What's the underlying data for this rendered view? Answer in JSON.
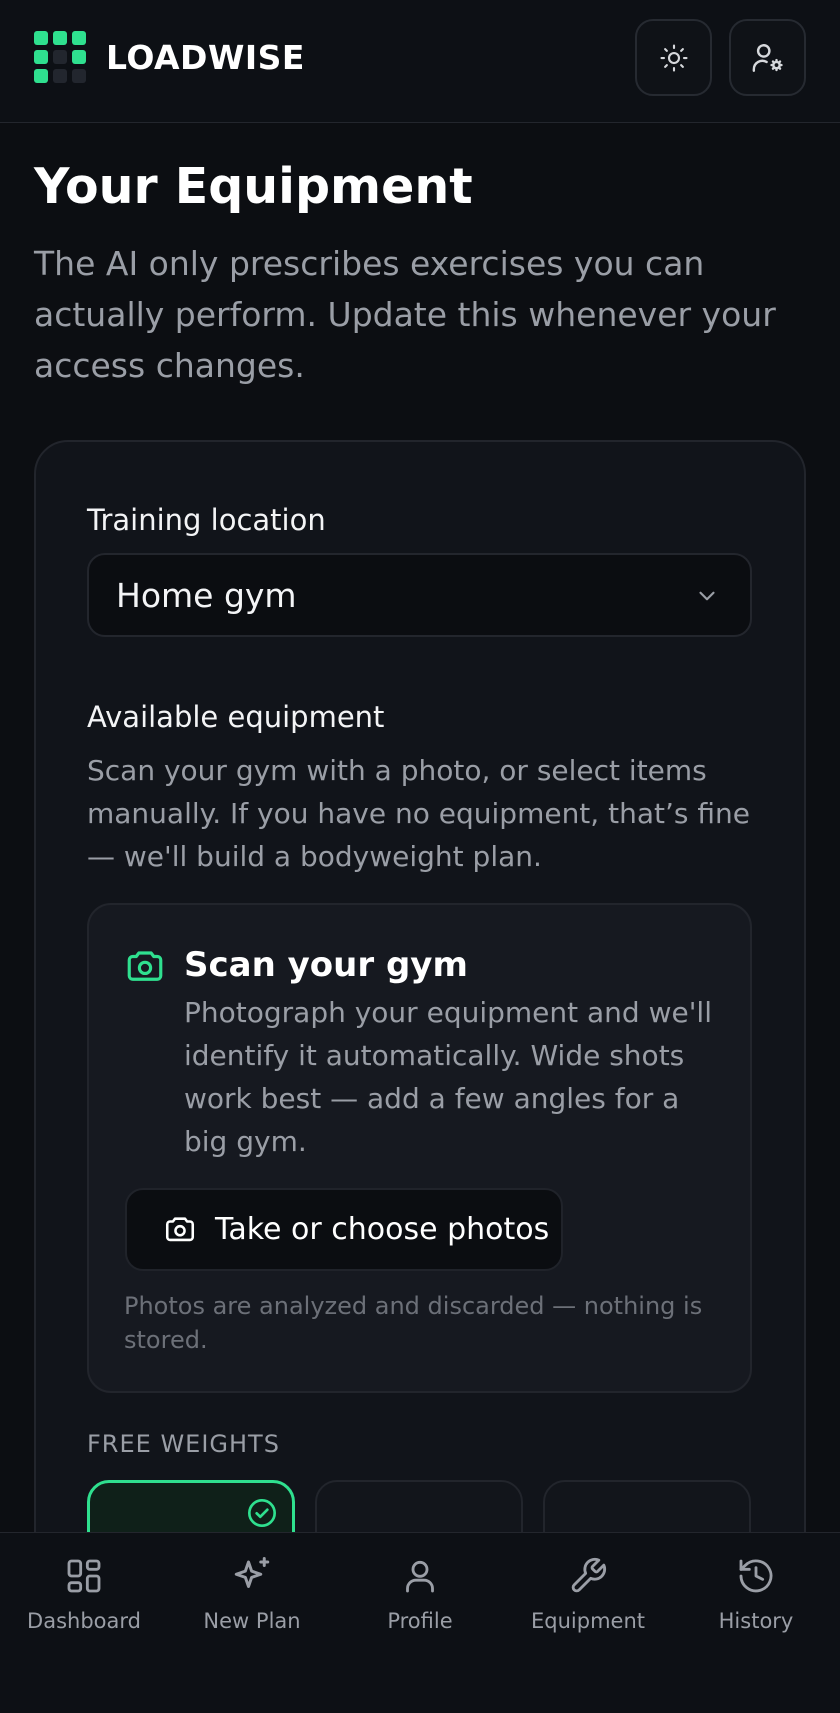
{
  "app": {
    "name": "LOADWISE"
  },
  "header": {
    "theme_button": "sun-icon",
    "account_button": "user-settings-icon"
  },
  "page": {
    "title": "Your Equipment",
    "description": "The AI only prescribes exercises you can actually perform. Update this whenever your access changes."
  },
  "form": {
    "location_label": "Training location",
    "location_value": "Home gym",
    "equipment_label": "Available equipment",
    "equipment_help": "Scan your gym with a photo, or select items manually. If you have no equipment, that’s fine — we'll build a bodyweight plan."
  },
  "scan": {
    "title": "Scan your gym",
    "description": "Photograph your equipment and we'll identify it automatically. Wide shots work best — add a few angles for a big gym.",
    "button_label": "Take or choose photos",
    "note": "Photos are analyzed and discarded — nothing is stored."
  },
  "equipment": {
    "section_title": "FREE WEIGHTS"
  },
  "nav": {
    "items": [
      {
        "label": "Dashboard",
        "icon": "dashboard-icon"
      },
      {
        "label": "New Plan",
        "icon": "sparkles-icon"
      },
      {
        "label": "Profile",
        "icon": "user-icon"
      },
      {
        "label": "Equipment",
        "icon": "wrench-icon"
      },
      {
        "label": "History",
        "icon": "history-icon"
      }
    ]
  },
  "colors": {
    "accent": "#2fe08f",
    "background": "#0c0e12",
    "muted_text": "#9a9ea6"
  }
}
